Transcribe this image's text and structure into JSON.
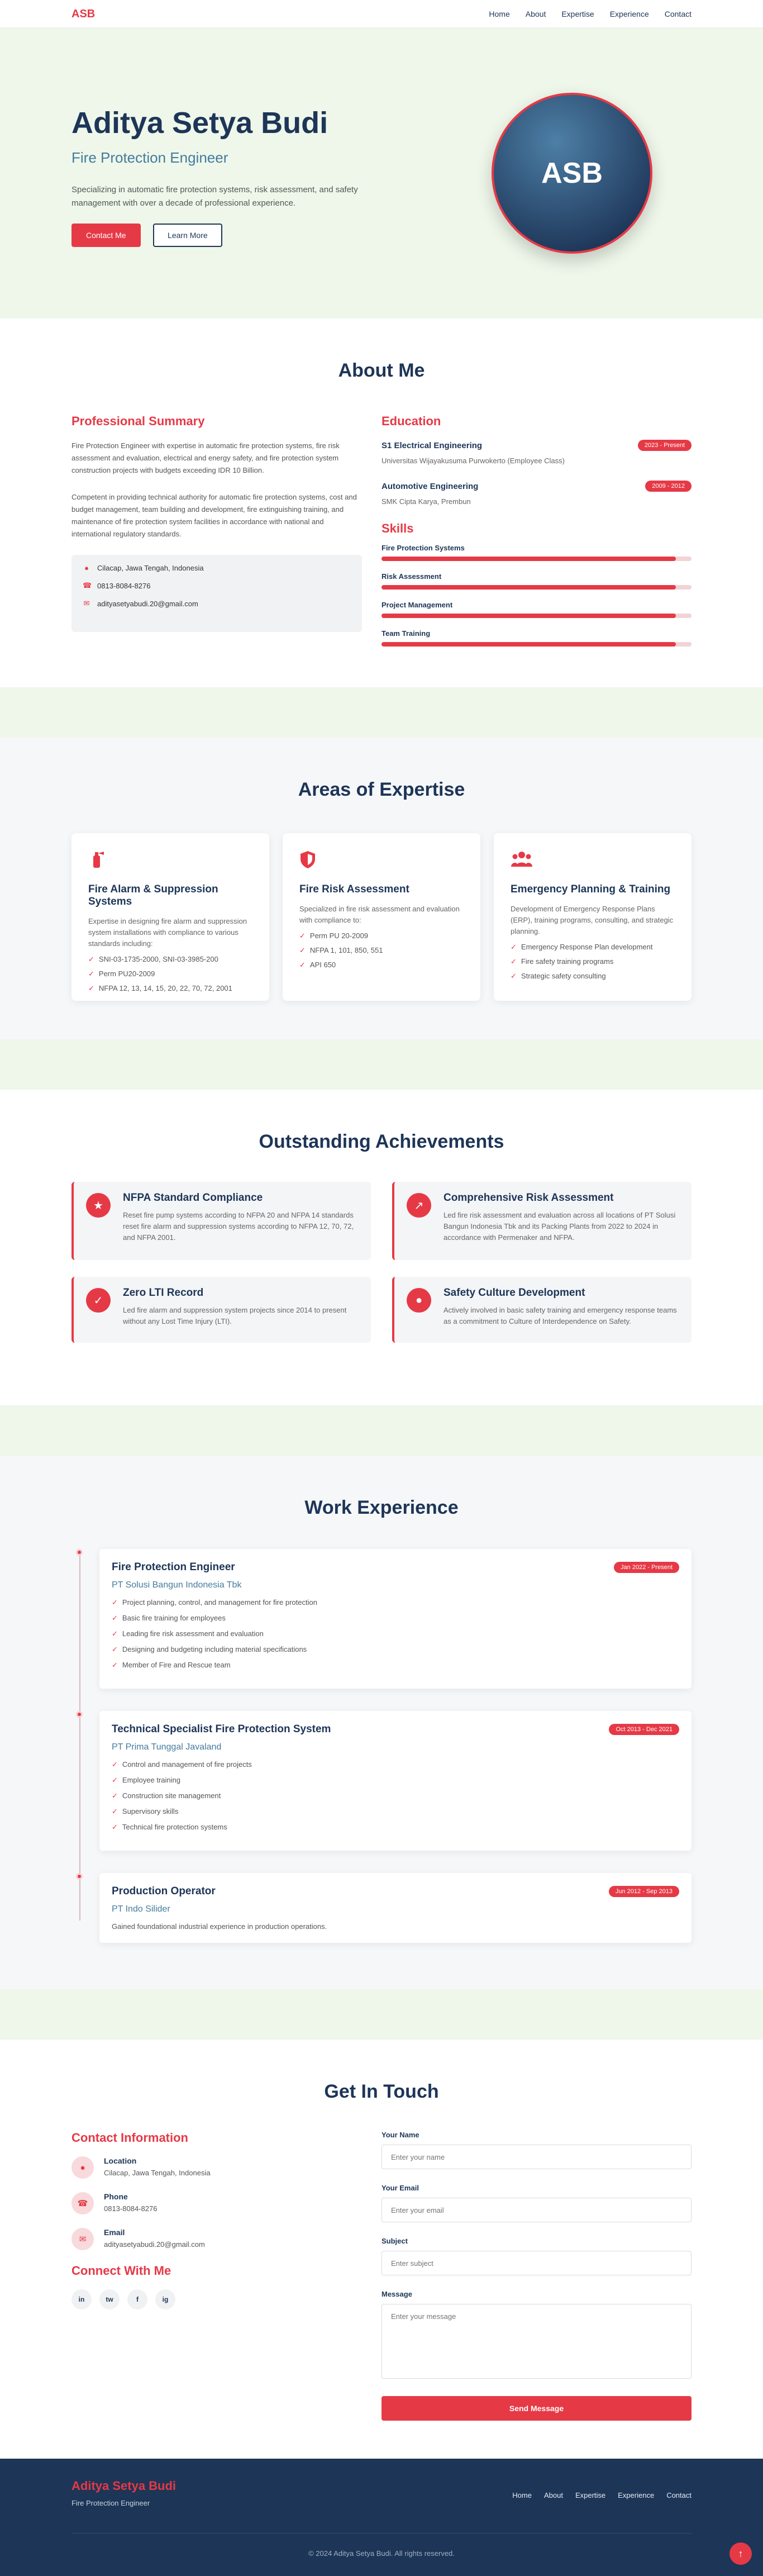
{
  "nav": {
    "logo": "ASB",
    "links": [
      "Home",
      "About",
      "Expertise",
      "Experience",
      "Contact"
    ]
  },
  "hero": {
    "name": "Aditya Setya Budi",
    "title": "Fire Protection Engineer",
    "description": "Specializing in automatic fire protection systems, risk assessment, and safety management with over a decade of professional experience.",
    "primary_button": "Contact Me",
    "secondary_button": "Learn More",
    "avatar_initials": "ASB"
  },
  "about": {
    "title": "About Me",
    "summary_heading": "Professional Summary",
    "summary_p1": "Fire Protection Engineer with expertise in automatic fire protection systems, fire risk assessment and evaluation, electrical and energy safety, and fire protection system construction projects with budgets exceeding IDR 10 Billion.",
    "summary_p2": "Competent in providing technical authority for automatic fire protection systems, cost and budget management, team building and development, fire extinguishing training, and maintenance of fire protection system facilities in accordance with national and international regulatory standards.",
    "contact": {
      "location": "Cilacap, Jawa Tengah, Indonesia",
      "phone": "0813-8084-8276",
      "email": "adityasetyabudi.20@gmail.com"
    },
    "education_heading": "Education",
    "education": [
      {
        "degree": "S1 Electrical Engineering",
        "school": "Universitas Wijayakusuma Purwokerto (Employee Class)",
        "period": "2023 - Present"
      },
      {
        "degree": "Automotive Engineering",
        "school": "SMK Cipta Karya, Prembun",
        "period": "2009 - 2012"
      }
    ],
    "skills_heading": "Skills",
    "skills": [
      {
        "name": "Fire Protection Systems",
        "level": 0.95
      },
      {
        "name": "Risk Assessment",
        "level": 0.95
      },
      {
        "name": "Project Management",
        "level": 0.95
      },
      {
        "name": "Team Training",
        "level": 0.95
      }
    ]
  },
  "expertise": {
    "title": "Areas of Expertise",
    "cards": [
      {
        "icon": "fire-extinguisher-icon",
        "title": "Fire Alarm & Suppression Systems",
        "description": "Expertise in designing fire alarm and suppression system installations with compliance to various standards including:",
        "items": [
          "SNI-03-1735-2000, SNI-03-3985-200",
          "Perm PU20-2009",
          "NFPA 12, 13, 14, 15, 20, 22, 70, 72, 2001"
        ]
      },
      {
        "icon": "shield-icon",
        "title": "Fire Risk Assessment",
        "description": "Specialized in fire risk assessment and evaluation with compliance to:",
        "items": [
          "Perm PU 20-2009",
          "NFPA 1, 101, 850, 551",
          "API 650"
        ]
      },
      {
        "icon": "users-icon",
        "title": "Emergency Planning & Training",
        "description": "Development of Emergency Response Plans (ERP), training programs, consulting, and strategic planning.",
        "items": [
          "Emergency Response Plan development",
          "Fire safety training programs",
          "Strategic safety consulting"
        ]
      }
    ]
  },
  "achievements": {
    "title": "Outstanding Achievements",
    "items": [
      {
        "icon": "trophy-icon",
        "title": "NFPA Standard Compliance",
        "description": "Reset fire pump systems according to NFPA 20 and NFPA 14 standards reset fire alarm and suppression systems according to NFPA 12, 70, 72, and NFPA 2001."
      },
      {
        "icon": "chart-icon",
        "title": "Comprehensive Risk Assessment",
        "description": "Led fire risk assessment and evaluation across all locations of PT Solusi Bangun Indonesia Tbk and its Packing Plants from 2022 to 2024 in accordance with Permenaker and NFPA."
      },
      {
        "icon": "shield-check-icon",
        "title": "Zero LTI Record",
        "description": "Led fire alarm and suppression system projects since 2014 to present without any Lost Time Injury (LTI)."
      },
      {
        "icon": "team-icon",
        "title": "Safety Culture Development",
        "description": "Actively involved in basic safety training and emergency response teams as a commitment to Culture of Interdependence on Safety."
      }
    ]
  },
  "work": {
    "title": "Work Experience",
    "jobs": [
      {
        "title": "Fire Protection Engineer",
        "company": "PT Solusi Bangun Indonesia Tbk",
        "period": "Jan 2022 - Present",
        "items": [
          "Project planning, control, and management for fire protection",
          "Basic fire training for employees",
          "Leading fire risk assessment and evaluation",
          "Designing and budgeting including material specifications",
          "Member of Fire and Rescue team"
        ]
      },
      {
        "title": "Technical Specialist Fire Protection System",
        "company": "PT Prima Tunggal Javaland",
        "period": "Oct 2013 - Dec 2021",
        "items": [
          "Control and management of fire projects",
          "Employee training",
          "Construction site management",
          "Supervisory skills",
          "Technical fire protection systems"
        ]
      },
      {
        "title": "Production Operator",
        "company": "PT Indo Silider",
        "period": "Jun 2012 - Sep 2013",
        "description": "Gained foundational industrial experience in production operations."
      }
    ]
  },
  "contact": {
    "title": "Get In Touch",
    "info_heading": "Contact Information",
    "location_label": "Location",
    "location": "Cilacap, Jawa Tengah, Indonesia",
    "phone_label": "Phone",
    "phone": "0813-8084-8276",
    "email_label": "Email",
    "email": "adityasetyabudi.20@gmail.com",
    "connect_heading": "Connect With Me",
    "socials": [
      "in",
      "tw",
      "f",
      "ig"
    ],
    "form": {
      "name_label": "Your Name",
      "name_placeholder": "Enter your name",
      "email_label": "Your Email",
      "email_placeholder": "Enter your email",
      "subject_label": "Subject",
      "subject_placeholder": "Enter subject",
      "message_label": "Message",
      "message_placeholder": "Enter your message",
      "submit": "Send Message"
    }
  },
  "footer": {
    "name": "Aditya Setya Budi",
    "role": "Fire Protection Engineer",
    "links": [
      "Home",
      "About",
      "Expertise",
      "Experience",
      "Contact"
    ],
    "copyright": "© 2024 Aditya Setya Budi. All rights reserved."
  },
  "colors": {
    "accent": "#e63946",
    "navy": "#1d3557",
    "blue": "#457b9d",
    "hero_bg": "#eef7ea"
  }
}
